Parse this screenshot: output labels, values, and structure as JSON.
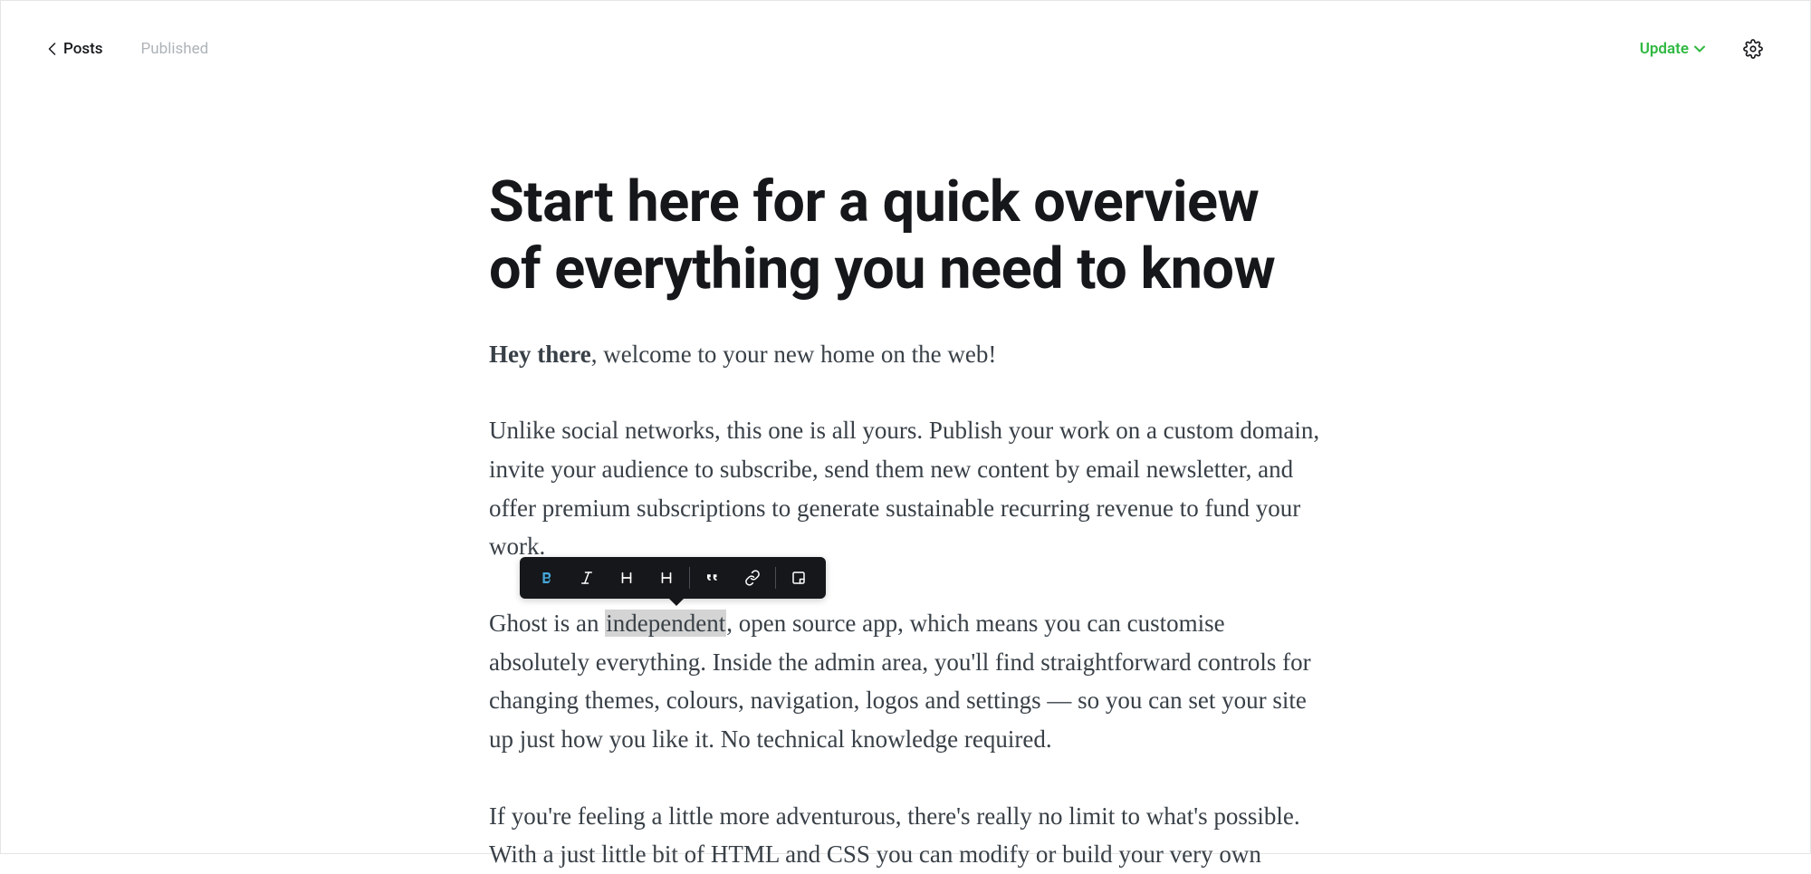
{
  "header": {
    "back_label": "Posts",
    "status": "Published",
    "update_label": "Update"
  },
  "post": {
    "title": "Start here for a quick overview of everything you need to know",
    "p1_strong": "Hey there",
    "p1_rest": ", welcome to your new home on the web!",
    "p2": "Unlike social networks, this one is all yours. Publish your work on a custom domain, invite your audience to subscribe, send them new content by email newsletter, and offer premium subscriptions to generate sustainable recurring revenue to fund your work.",
    "p3_a": "Ghost is an ",
    "p3_sel": "independent",
    "p3_b": ", open source app, which means you can customise absolutely everything. Inside the admin area, you'll find straightforward controls for changing themes, colours, navigation, logos and settings — so you can set your site up just how you like it. No technical knowledge required.",
    "p4": "If you're feeling a little more adventurous, there's really no limit to what's possible. With a just little bit of HTML and CSS you can modify or build your very own"
  },
  "toolbar": {
    "bold_active": true
  }
}
